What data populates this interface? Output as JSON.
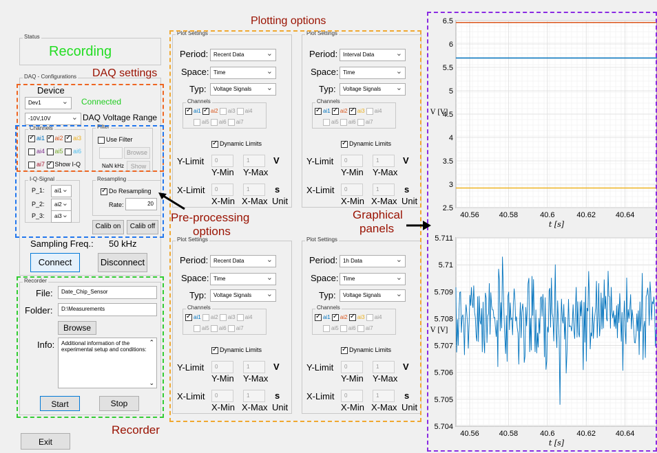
{
  "status": {
    "title": "Status",
    "text": "Recording"
  },
  "daq": {
    "title": "DAQ - Configurations",
    "device_label": "Device",
    "device_value": "Dev1",
    "connected": "Connected",
    "range_value": "-10V,10V",
    "range_label": "DAQ Voltage Range",
    "channels_title": "Channels",
    "channels": [
      "ai1",
      "ai2",
      "ai3",
      "ai4",
      "ai5",
      "ai6",
      "ai7"
    ],
    "show_iq": "Show I-Q"
  },
  "filter": {
    "title": "Filter",
    "use": "Use Filter",
    "browse": "Browse",
    "nan": "NaN kHz",
    "show": "Show"
  },
  "iq": {
    "title": "I-Q-Signal",
    "p1": "P_1:",
    "p2": "P_2:",
    "p3": "P_3:",
    "v1": "ai1",
    "v2": "ai2",
    "v3": "ai3"
  },
  "resampling": {
    "title": "Resampling",
    "do": "Do Resampling",
    "rate_label": "Rate:",
    "rate": "20"
  },
  "calib": {
    "on": "Calib on",
    "off": "Calib off"
  },
  "sampling": {
    "label": "Sampling Freq.:",
    "value": "50 kHz"
  },
  "connect": "Connect",
  "disconnect": "Disconnect",
  "recorder": {
    "title": "Recorder",
    "file_label": "File:",
    "file": "Date_Chip_Sensor",
    "folder_label": "Folder:",
    "folder": "D:\\Measurements",
    "browse": "Browse",
    "info_label": "Info:",
    "info": "Additional information of the experimental setup and conditions:",
    "start": "Start",
    "stop": "Stop"
  },
  "exit": "Exit",
  "plot_settings": {
    "title": "Plot Settings",
    "period_label": "Period:",
    "space_label": "Space:",
    "typ_label": "Typ:",
    "channels_title": "Channels",
    "dyn": "Dynamic Limits",
    "ylimit": "Y-Limit",
    "xlimit": "X-Limit",
    "min": "0",
    "max": "1",
    "ymin": "Y-Min",
    "ymax": "Y-Max",
    "xmin": "X-Min",
    "xmax": "X-Max",
    "unit": "Unit",
    "v": "V",
    "s": "s",
    "space": "Time",
    "typ": "Voltage Signals",
    "periods": [
      "Recent Data",
      "Interval Data",
      "Recent Data",
      "1h Data"
    ]
  },
  "annotations": {
    "plotting": "Plotting options",
    "daq": "DAQ settings",
    "pre1": "Pre-processing",
    "pre2": "options",
    "graph1": "Graphical",
    "graph2": "panels",
    "recorder": "Recorder"
  },
  "colors": {
    "ai1": "#0072bd",
    "ai2": "#d95319",
    "ai3": "#edb120",
    "ai4": "#7e2f8e",
    "ai5": "#77ac30",
    "ai6": "#4dbeee",
    "ai7": "#a2142f",
    "connected": "#22cc22",
    "recording": "#22dd22"
  },
  "chart_data": [
    {
      "type": "line",
      "x_ticks": [
        "40.56",
        "40.58",
        "40.6",
        "40.62",
        "40.64"
      ],
      "y_ticks": [
        "2.5",
        "3",
        "3.5",
        "4",
        "4.5",
        "5",
        "5.5",
        "6",
        "6.5"
      ],
      "xlabel": "t [s]",
      "ylabel": "V [V]",
      "ylim": [
        2.5,
        6.5
      ],
      "series": [
        {
          "color": "#d95319",
          "values": [
            6.46,
            6.46
          ]
        },
        {
          "color": "#0072bd",
          "values": [
            5.7,
            5.7
          ]
        },
        {
          "color": "#edb120",
          "values": [
            2.92,
            2.92
          ]
        }
      ]
    },
    {
      "type": "line",
      "x_ticks": [
        "40.56",
        "40.58",
        "40.6",
        "40.62",
        "40.64"
      ],
      "y_ticks": [
        "5.704",
        "5.705",
        "5.706",
        "5.707",
        "5.708",
        "5.709",
        "5.71",
        "5.711"
      ],
      "xlabel": "t [s]",
      "ylabel": "V [V]",
      "ylim": [
        5.704,
        5.711
      ],
      "series": [
        {
          "color": "#0072bd",
          "mean": 5.708,
          "min": 5.7048,
          "max": 5.7103
        }
      ]
    }
  ]
}
